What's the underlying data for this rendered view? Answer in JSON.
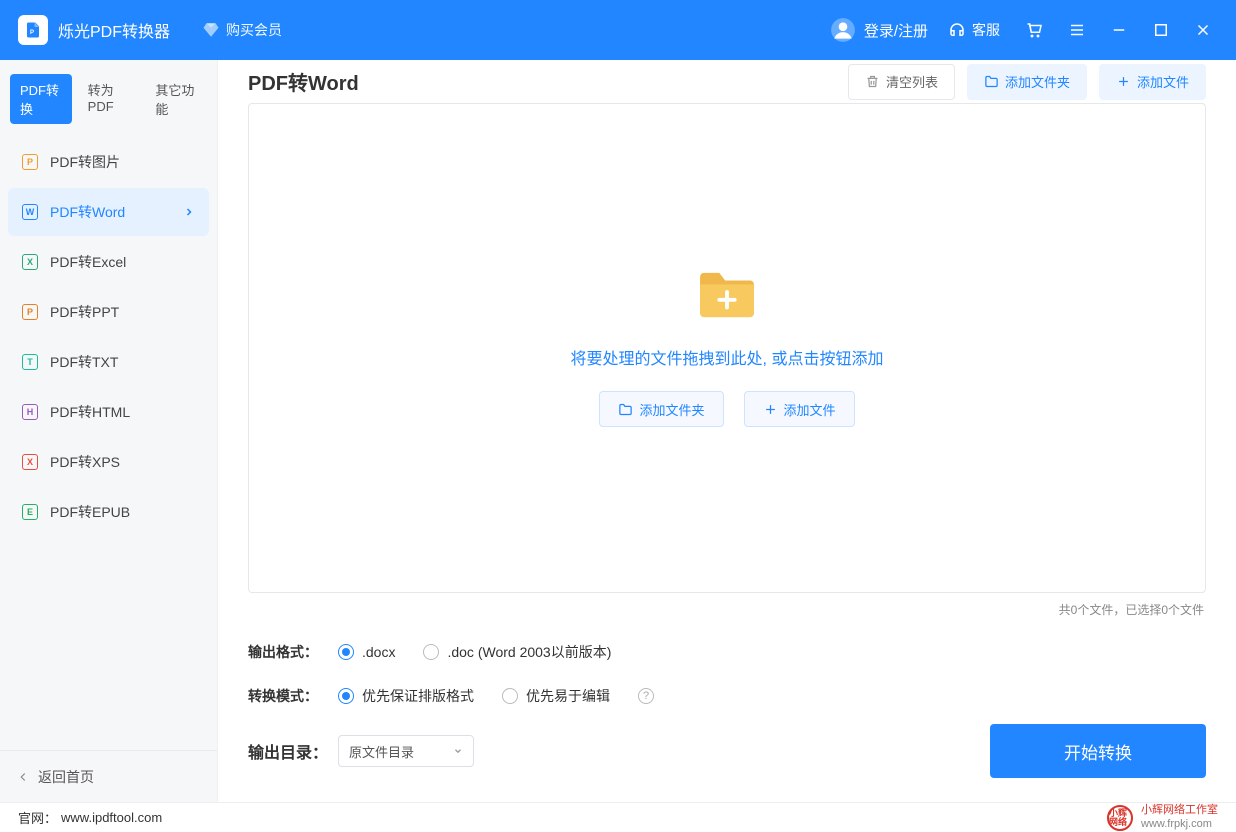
{
  "titlebar": {
    "app_name": "烁光PDF转换器",
    "vip": "购买会员",
    "auth": "登录/注册",
    "support": "客服"
  },
  "sidebar": {
    "tabs": [
      "PDF转换",
      "转为PDF",
      "其它功能"
    ],
    "items": [
      {
        "label": "PDF转图片",
        "abbr": "P"
      },
      {
        "label": "PDF转Word",
        "abbr": "W"
      },
      {
        "label": "PDF转Excel",
        "abbr": "X"
      },
      {
        "label": "PDF转PPT",
        "abbr": "P"
      },
      {
        "label": "PDF转TXT",
        "abbr": "T"
      },
      {
        "label": "PDF转HTML",
        "abbr": "H"
      },
      {
        "label": "PDF转XPS",
        "abbr": "X"
      },
      {
        "label": "PDF转EPUB",
        "abbr": "E"
      }
    ],
    "back": "返回首页"
  },
  "main": {
    "title": "PDF转Word",
    "clear": "清空列表",
    "add_folder": "添加文件夹",
    "add_file": "添加文件",
    "drop_text": "将要处理的文件拖拽到此处, 或点击按钮添加",
    "status": "共0个文件，已选择0个文件"
  },
  "options": {
    "format_label": "输出格式：",
    "format_docx": ".docx",
    "format_doc": ".doc (Word 2003以前版本)",
    "mode_label": "转换模式：",
    "mode_layout": "优先保证排版格式",
    "mode_edit": "优先易于编辑",
    "outdir_label": "输出目录：",
    "outdir_value": "原文件目录",
    "convert": "开始转换"
  },
  "footer": {
    "label": "官网：",
    "url": "www.ipdftool.com",
    "watermark_name": "小辉网络工作室",
    "watermark_url": "www.frpkj.com",
    "watermark_logo": "小辉网络"
  }
}
